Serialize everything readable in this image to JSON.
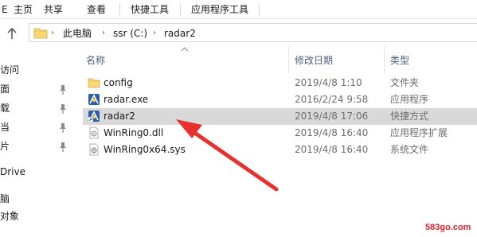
{
  "ribbon": {
    "tabs": [
      "主页",
      "共享",
      "查看",
      "快捷工具",
      "应用程序工具"
    ],
    "file_tab_fragment": "E"
  },
  "address": {
    "crumbs": [
      "此电脑",
      "ssr (C:)",
      "radar2"
    ]
  },
  "nav": {
    "items": [
      {
        "label": "访问"
      },
      {
        "label": "面"
      },
      {
        "label": "载"
      },
      {
        "label": "当"
      },
      {
        "label": "片"
      },
      {
        "label": "Drive"
      },
      {
        "label": "脑"
      },
      {
        "label": "对象"
      }
    ]
  },
  "columns": {
    "name": "名称",
    "date": "修改日期",
    "type": "类型"
  },
  "files": [
    {
      "name": "config",
      "date": "2019/4/8 1:10",
      "type": "文件夹",
      "icon": "folder-icon",
      "selected": false
    },
    {
      "name": "radar.exe",
      "date": "2016/2/24 9:58",
      "type": "应用程序",
      "icon": "radar-app-icon",
      "selected": false
    },
    {
      "name": "radar2",
      "date": "2019/4/8 17:06",
      "type": "快捷方式",
      "icon": "radar-shortcut-icon",
      "selected": true
    },
    {
      "name": "WinRing0.dll",
      "date": "2019/4/8 16:40",
      "type": "应用程序扩展",
      "icon": "dll-file-icon",
      "selected": false
    },
    {
      "name": "WinRing0x64.sys",
      "date": "2019/4/8 16:40",
      "type": "系统文件",
      "icon": "sys-file-icon",
      "selected": false
    }
  ],
  "watermark": "583go.com",
  "colors": {
    "selection": "#d9d9d9",
    "annotation_arrow": "#e8312f",
    "header_text": "#4c607a"
  }
}
